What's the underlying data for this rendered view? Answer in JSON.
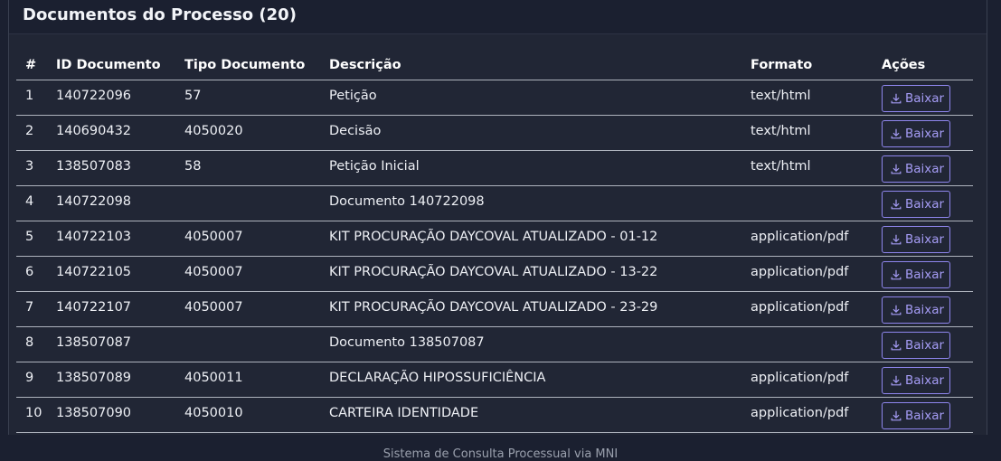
{
  "section": {
    "title": "Documentos do Processo (20)"
  },
  "table": {
    "headers": [
      "#",
      "ID Documento",
      "Tipo Documento",
      "Descrição",
      "Formato",
      "Ações"
    ],
    "rows": [
      {
        "n": "1",
        "id": "140722096",
        "tipo": "57",
        "descricao": "Petição",
        "formato": "text/html",
        "acao": "Baixar"
      },
      {
        "n": "2",
        "id": "140690432",
        "tipo": "4050020",
        "descricao": "Decisão",
        "formato": "text/html",
        "acao": "Baixar"
      },
      {
        "n": "3",
        "id": "138507083",
        "tipo": "58",
        "descricao": "Petição Inicial",
        "formato": "text/html",
        "acao": "Baixar"
      },
      {
        "n": "4",
        "id": "140722098",
        "tipo": "",
        "descricao": "Documento 140722098",
        "formato": "",
        "acao": "Baixar"
      },
      {
        "n": "5",
        "id": "140722103",
        "tipo": "4050007",
        "descricao": "KIT PROCURAÇÃO DAYCOVAL ATUALIZADO - 01-12",
        "formato": "application/pdf",
        "acao": "Baixar"
      },
      {
        "n": "6",
        "id": "140722105",
        "tipo": "4050007",
        "descricao": "KIT PROCURAÇÃO DAYCOVAL ATUALIZADO - 13-22",
        "formato": "application/pdf",
        "acao": "Baixar"
      },
      {
        "n": "7",
        "id": "140722107",
        "tipo": "4050007",
        "descricao": "KIT PROCURAÇÃO DAYCOVAL ATUALIZADO - 23-29",
        "formato": "application/pdf",
        "acao": "Baixar"
      },
      {
        "n": "8",
        "id": "138507087",
        "tipo": "",
        "descricao": "Documento 138507087",
        "formato": "",
        "acao": "Baixar"
      },
      {
        "n": "9",
        "id": "138507089",
        "tipo": "4050011",
        "descricao": "DECLARAÇÃO HIPOSSUFICIÊNCIA",
        "formato": "application/pdf",
        "acao": "Baixar"
      },
      {
        "n": "10",
        "id": "138507090",
        "tipo": "4050010",
        "descricao": "CARTEIRA IDENTIDADE",
        "formato": "application/pdf",
        "acao": "Baixar"
      }
    ]
  },
  "icons": {
    "download": "download-icon"
  },
  "colors": {
    "accent": "#8f86ee",
    "background": "#212635"
  },
  "footer": {
    "text": "Sistema de Consulta Processual via MNI"
  }
}
